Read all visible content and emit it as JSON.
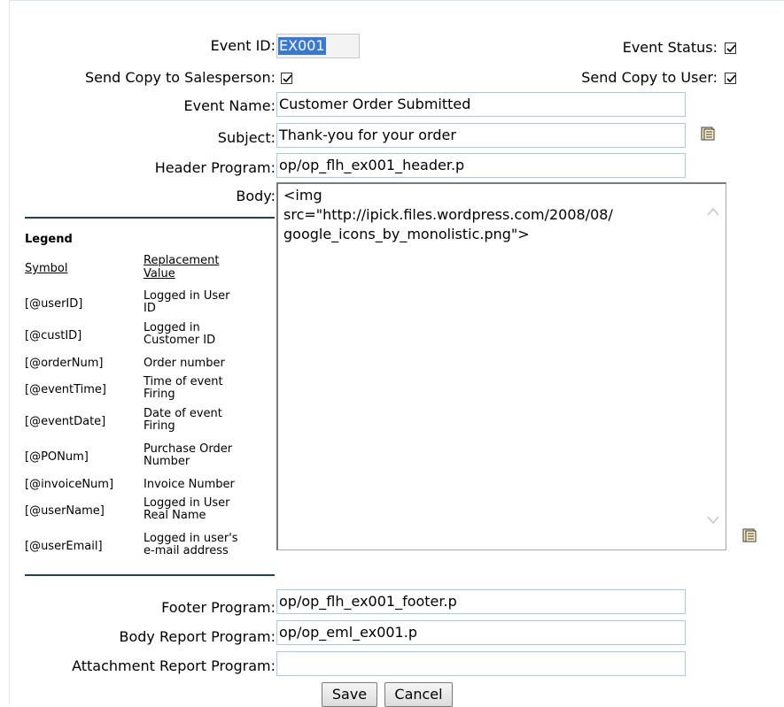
{
  "form": {
    "event_id_label": "Event ID:",
    "event_id_value": "EX001",
    "event_status_label": "Event Status:",
    "event_status_checked": true,
    "send_copy_salesperson_label": "Send Copy to Salesperson:",
    "send_copy_salesperson_checked": true,
    "send_copy_user_label": "Send Copy to User:",
    "send_copy_user_checked": true,
    "event_name_label": "Event Name:",
    "event_name_value": "Customer Order Submitted",
    "subject_label": "Subject:",
    "subject_value": "Thank-you for your order",
    "header_program_label": "Header Program:",
    "header_program_value": "op/op_flh_ex001_header.p",
    "body_label": "Body:",
    "body_value": "<img\nsrc=\"http://ipick.files.wordpress.com/2008/08/\ngoogle_icons_by_monolistic.png\">",
    "footer_program_label": "Footer Program:",
    "footer_program_value": "op/op_flh_ex001_footer.p",
    "body_report_program_label": "Body Report Program:",
    "body_report_program_value": "op/op_eml_ex001.p",
    "attachment_report_program_label": "Attachment Report Program:",
    "attachment_report_program_value": ""
  },
  "legend": {
    "title": "Legend",
    "symbol_header": "Symbol",
    "replacement_header_1": "Replacement",
    "replacement_header_2": "Value",
    "rows": [
      {
        "symbol": "[@userID]",
        "v1": "Logged in User",
        "v2": "ID"
      },
      {
        "symbol": "[@custID]",
        "v1": "Logged in",
        "v2": "Customer ID"
      },
      {
        "symbol": "[@orderNum]",
        "v1": "Order number",
        "v2": ""
      },
      {
        "symbol": "[@eventTime]",
        "v1": "Time of event",
        "v2": "Firing"
      },
      {
        "symbol": "[@eventDate]",
        "v1": "Date of event",
        "v2": "Firing"
      },
      {
        "symbol": "[@PONum]",
        "v1": "Purchase Order",
        "v2": "Number"
      },
      {
        "symbol": "[@invoiceNum]",
        "v1": "Invoice Number",
        "v2": ""
      },
      {
        "symbol": "[@userName]",
        "v1": "Logged in User",
        "v2": "Real Name"
      },
      {
        "symbol": "[@userEmail]",
        "v1": "Logged in user's",
        "v2": "e-mail address"
      }
    ]
  },
  "buttons": {
    "save_label": "Save",
    "cancel_label": "Cancel"
  },
  "icons": {
    "subject_editor": "edit-document-icon",
    "body_editor": "edit-document-icon"
  },
  "colors": {
    "field_border": "#a8c9ef",
    "selection": "#3a78d8",
    "separator": "#1f3f6b"
  }
}
